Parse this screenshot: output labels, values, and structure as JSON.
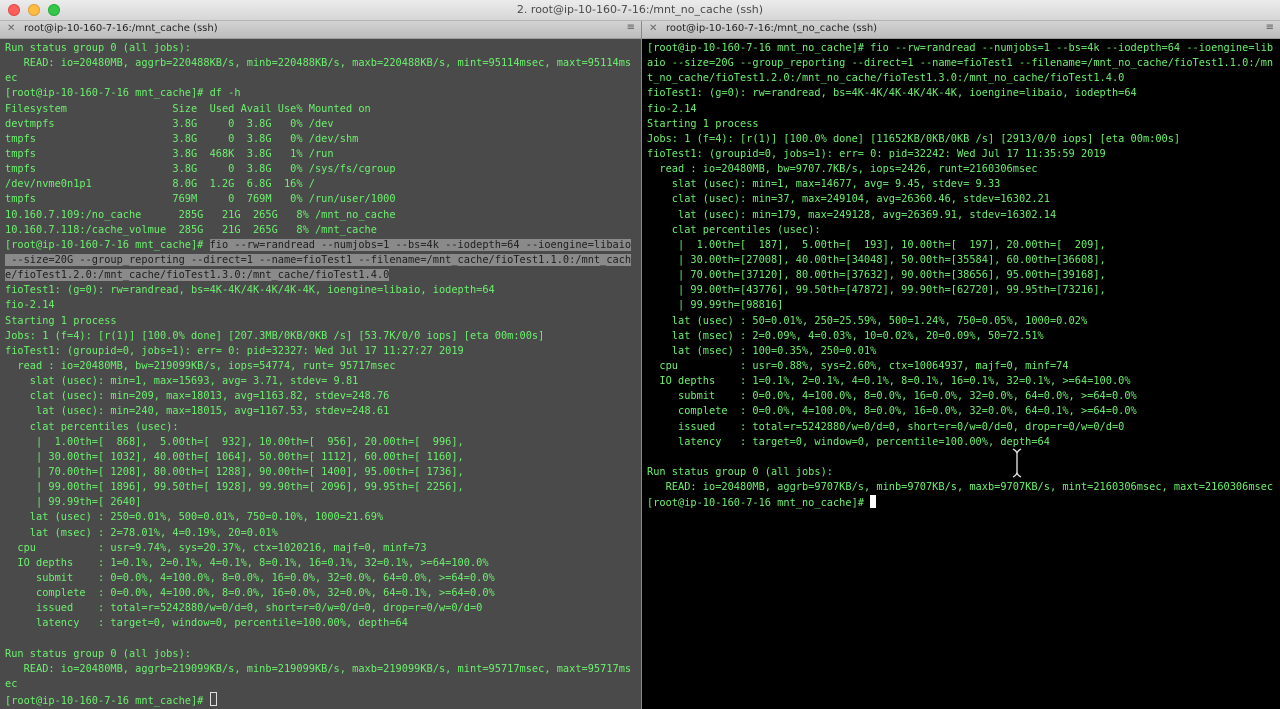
{
  "window": {
    "title": "2. root@ip-10-160-7-16:/mnt_no_cache (ssh)"
  },
  "tabs": [
    {
      "label": "root@ip-10-160-7-16:/mnt_cache (ssh)",
      "close": "✕",
      "menu": "≡"
    },
    {
      "label": "root@ip-10-160-7-16:/mnt_no_cache (ssh)",
      "close": "✕",
      "menu": "≡"
    }
  ],
  "left_lines": [
    {
      "text": "Run status group 0 (all jobs):"
    },
    {
      "text": "   READ: io=20480MB, aggrb=220488KB/s, minb=220488KB/s, maxb=220488KB/s, mint=95114msec, maxt=95114ms"
    },
    {
      "text": "ec"
    },
    {
      "text": "[root@ip-10-160-7-16 mnt_cache]# df -h"
    },
    {
      "text": "Filesystem                 Size  Used Avail Use% Mounted on"
    },
    {
      "text": "devtmpfs                   3.8G     0  3.8G   0% /dev"
    },
    {
      "text": "tmpfs                      3.8G     0  3.8G   0% /dev/shm"
    },
    {
      "text": "tmpfs                      3.8G  468K  3.8G   1% /run"
    },
    {
      "text": "tmpfs                      3.8G     0  3.8G   0% /sys/fs/cgroup"
    },
    {
      "text": "/dev/nvme0n1p1             8.0G  1.2G  6.8G  16% /"
    },
    {
      "text": "tmpfs                      769M     0  769M   0% /run/user/1000"
    },
    {
      "text": "10.160.7.109:/no_cache      285G   21G  265G   8% /mnt_no_cache"
    },
    {
      "text": "10.160.7.118:/cache_volmue  285G   21G  265G   8% /mnt_cache"
    },
    {
      "prefix": "[root@ip-10-160-7-16 mnt_cache]# ",
      "text": "fio --rw=randread --numjobs=1 --bs=4k --iodepth=64 --ioengine=libaio"
    },
    {
      "text": " --size=20G --group_reporting --direct=1 --name=fioTest1 --filename=/mnt_cache/fioTest1.1.0:/mnt_cach",
      "selected": true
    },
    {
      "text": "e/fioTest1.2.0:/mnt_cache/fioTest1.3.0:/mnt_cache/fioTest1.4.0",
      "selected": true
    },
    {
      "text": "fioTest1: (g=0): rw=randread, bs=4K-4K/4K-4K/4K-4K, ioengine=libaio, iodepth=64"
    },
    {
      "text": "fio-2.14"
    },
    {
      "text": "Starting 1 process"
    },
    {
      "text": "Jobs: 1 (f=4): [r(1)] [100.0% done] [207.3MB/0KB/0KB /s] [53.7K/0/0 iops] [eta 00m:00s]"
    },
    {
      "text": "fioTest1: (groupid=0, jobs=1): err= 0: pid=32327: Wed Jul 17 11:27:27 2019"
    },
    {
      "text": "  read : io=20480MB, bw=219099KB/s, iops=54774, runt= 95717msec"
    },
    {
      "text": "    slat (usec): min=1, max=15693, avg= 3.71, stdev= 9.81"
    },
    {
      "text": "    clat (usec): min=209, max=18013, avg=1163.82, stdev=248.76"
    },
    {
      "text": "     lat (usec): min=240, max=18015, avg=1167.53, stdev=248.61"
    },
    {
      "text": "    clat percentiles (usec):"
    },
    {
      "text": "     |  1.00th=[  868],  5.00th=[  932], 10.00th=[  956], 20.00th=[  996],"
    },
    {
      "text": "     | 30.00th=[ 1032], 40.00th=[ 1064], 50.00th=[ 1112], 60.00th=[ 1160],"
    },
    {
      "text": "     | 70.00th=[ 1208], 80.00th=[ 1288], 90.00th=[ 1400], 95.00th=[ 1736],"
    },
    {
      "text": "     | 99.00th=[ 1896], 99.50th=[ 1928], 99.90th=[ 2096], 99.95th=[ 2256],"
    },
    {
      "text": "     | 99.99th=[ 2640]"
    },
    {
      "text": "    lat (usec) : 250=0.01%, 500=0.01%, 750=0.10%, 1000=21.69%"
    },
    {
      "text": "    lat (msec) : 2=78.01%, 4=0.19%, 20=0.01%"
    },
    {
      "text": "  cpu          : usr=9.74%, sys=20.37%, ctx=1020216, majf=0, minf=73"
    },
    {
      "text": "  IO depths    : 1=0.1%, 2=0.1%, 4=0.1%, 8=0.1%, 16=0.1%, 32=0.1%, >=64=100.0%"
    },
    {
      "text": "     submit    : 0=0.0%, 4=100.0%, 8=0.0%, 16=0.0%, 32=0.0%, 64=0.0%, >=64=0.0%"
    },
    {
      "text": "     complete  : 0=0.0%, 4=100.0%, 8=0.0%, 16=0.0%, 32=0.0%, 64=0.1%, >=64=0.0%"
    },
    {
      "text": "     issued    : total=r=5242880/w=0/d=0, short=r=0/w=0/d=0, drop=r=0/w=0/d=0"
    },
    {
      "text": "     latency   : target=0, window=0, percentile=100.00%, depth=64"
    },
    {
      "text": ""
    },
    {
      "text": "Run status group 0 (all jobs):"
    },
    {
      "text": "   READ: io=20480MB, aggrb=219099KB/s, minb=219099KB/s, maxb=219099KB/s, mint=95717msec, maxt=95717ms"
    },
    {
      "text": "ec"
    },
    {
      "text": "[root@ip-10-160-7-16 mnt_cache]# ",
      "cursor": "hollow"
    }
  ],
  "right_lines": [
    {
      "text": "[root@ip-10-160-7-16 mnt_no_cache]# fio --rw=randread --numjobs=1 --bs=4k --iodepth=64 --ioengine=lib"
    },
    {
      "text": "aio --size=20G --group_reporting --direct=1 --name=fioTest1 --filename=/mnt_no_cache/fioTest1.1.0:/mn"
    },
    {
      "text": "t_no_cache/fioTest1.2.0:/mnt_no_cache/fioTest1.3.0:/mnt_no_cache/fioTest1.4.0"
    },
    {
      "text": "fioTest1: (g=0): rw=randread, bs=4K-4K/4K-4K/4K-4K, ioengine=libaio, iodepth=64"
    },
    {
      "text": "fio-2.14"
    },
    {
      "text": "Starting 1 process"
    },
    {
      "text": "Jobs: 1 (f=4): [r(1)] [100.0% done] [11652KB/0KB/0KB /s] [2913/0/0 iops] [eta 00m:00s]"
    },
    {
      "text": "fioTest1: (groupid=0, jobs=1): err= 0: pid=32242: Wed Jul 17 11:35:59 2019"
    },
    {
      "text": "  read : io=20480MB, bw=9707.7KB/s, iops=2426, runt=2160306msec"
    },
    {
      "text": "    slat (usec): min=1, max=14677, avg= 9.45, stdev= 9.33"
    },
    {
      "text": "    clat (usec): min=37, max=249104, avg=26360.46, stdev=16302.21"
    },
    {
      "text": "     lat (usec): min=179, max=249128, avg=26369.91, stdev=16302.14"
    },
    {
      "text": "    clat percentiles (usec):"
    },
    {
      "text": "     |  1.00th=[  187],  5.00th=[  193], 10.00th=[  197], 20.00th=[  209],"
    },
    {
      "text": "     | 30.00th=[27008], 40.00th=[34048], 50.00th=[35584], 60.00th=[36608],"
    },
    {
      "text": "     | 70.00th=[37120], 80.00th=[37632], 90.00th=[38656], 95.00th=[39168],"
    },
    {
      "text": "     | 99.00th=[43776], 99.50th=[47872], 99.90th=[62720], 99.95th=[73216],"
    },
    {
      "text": "     | 99.99th=[98816]"
    },
    {
      "text": "    lat (usec) : 50=0.01%, 250=25.59%, 500=1.24%, 750=0.05%, 1000=0.02%"
    },
    {
      "text": "    lat (msec) : 2=0.09%, 4=0.03%, 10=0.02%, 20=0.09%, 50=72.51%"
    },
    {
      "text": "    lat (msec) : 100=0.35%, 250=0.01%"
    },
    {
      "text": "  cpu          : usr=0.88%, sys=2.60%, ctx=10064937, majf=0, minf=74"
    },
    {
      "text": "  IO depths    : 1=0.1%, 2=0.1%, 4=0.1%, 8=0.1%, 16=0.1%, 32=0.1%, >=64=100.0%"
    },
    {
      "text": "     submit    : 0=0.0%, 4=100.0%, 8=0.0%, 16=0.0%, 32=0.0%, 64=0.0%, >=64=0.0%"
    },
    {
      "text": "     complete  : 0=0.0%, 4=100.0%, 8=0.0%, 16=0.0%, 32=0.0%, 64=0.1%, >=64=0.0%"
    },
    {
      "text": "     issued    : total=r=5242880/w=0/d=0, short=r=0/w=0/d=0, drop=r=0/w=0/d=0"
    },
    {
      "text": "     latency   : target=0, window=0, percentile=100.00%, depth=64"
    },
    {
      "text": ""
    },
    {
      "text": "Run status group 0 (all jobs):"
    },
    {
      "text": "   READ: io=20480MB, aggrb=9707KB/s, minb=9707KB/s, maxb=9707KB/s, mint=2160306msec, maxt=2160306msec"
    },
    {
      "text": "[root@ip-10-160-7-16 mnt_no_cache]# ",
      "cursor": "block"
    }
  ]
}
